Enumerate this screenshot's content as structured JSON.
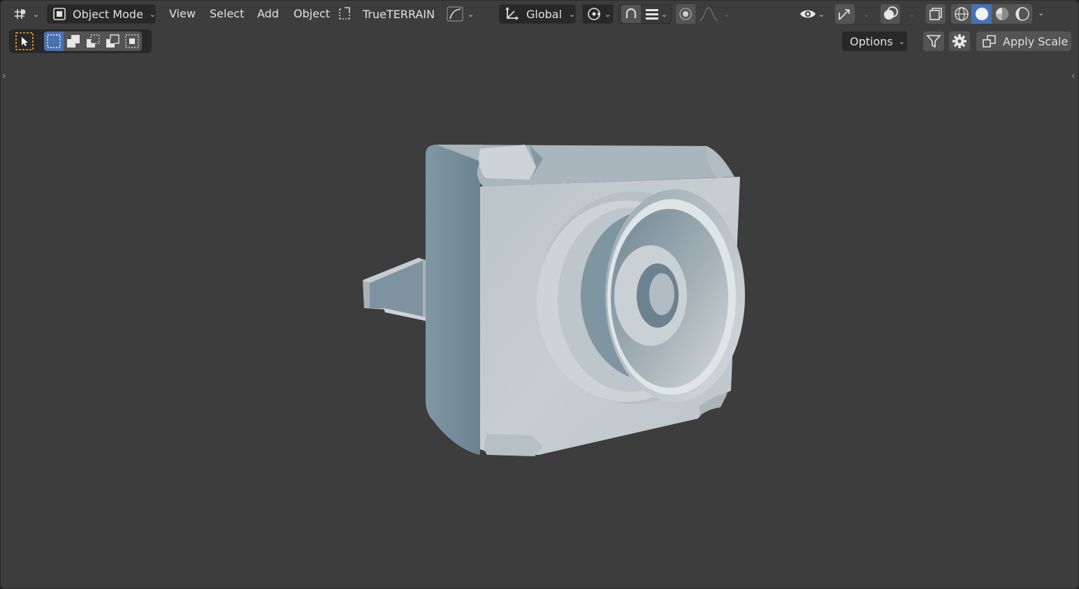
{
  "header": {
    "mode_label": "Object Mode",
    "menus": [
      "View",
      "Select",
      "Add",
      "Object"
    ],
    "addon_label": "TrueTERRAIN",
    "orientation_label": "Global"
  },
  "toolbar": {
    "options_label": "Options",
    "apply_scale_label": "Apply Scale"
  },
  "icons": {
    "editor_type": "gizmo-editor-icon",
    "mode": "object-mode-icon",
    "addon": "terrain-icon",
    "curve": "curve-icon",
    "transform": "transform-axes-icon",
    "pivot": "pivot-icon",
    "snap": "magnet-icon",
    "proportional": "proportional-icon",
    "visibility": "eye-icon",
    "gizmo": "gizmo-icon",
    "overlay": "overlay-icon",
    "xray": "xray-icon",
    "shading": [
      "wireframe-icon",
      "solid-icon",
      "material-icon",
      "rendered-icon"
    ],
    "filter": "filter-icon",
    "settings": "gear-icon"
  },
  "colors": {
    "viewport_bg": "#3d3d3d",
    "header_widget": "#282828",
    "button": "#545454",
    "accent_blue": "#4772b3",
    "select_orange": "#f5a623",
    "model_light": "#c9d0d3",
    "model_shadow": "#6e8492"
  }
}
